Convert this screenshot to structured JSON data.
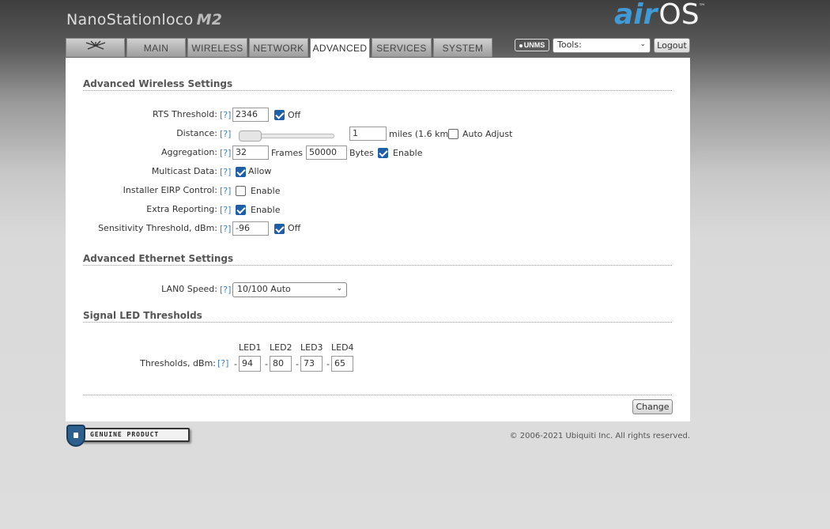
{
  "brand": {
    "name": "NanoStation",
    "model": "loco",
    "suffix": "M2"
  },
  "os_logo": {
    "air": "air",
    "os": "OS",
    "tm": "™"
  },
  "tabs": [
    {
      "label": "",
      "icon": "ubiquiti-logo-icon"
    },
    {
      "label": "MAIN"
    },
    {
      "label": "WIRELESS"
    },
    {
      "label": "NETWORK"
    },
    {
      "label": "ADVANCED",
      "active": true
    },
    {
      "label": "SERVICES"
    },
    {
      "label": "SYSTEM"
    }
  ],
  "header": {
    "unms_label": "UNMS",
    "tools": {
      "selected": "Tools:"
    },
    "logout_label": "Logout"
  },
  "advanced_wireless": {
    "title": "Advanced Wireless Settings",
    "help": "[?]",
    "rts": {
      "label": "RTS Threshold:",
      "value": "2346",
      "off_label": "Off",
      "off_checked": true
    },
    "distance": {
      "label": "Distance:",
      "value": "1",
      "unit": "miles (1.6 km)",
      "slider_fraction": 0.0,
      "auto_label": "Auto Adjust",
      "auto_checked": false
    },
    "aggregation": {
      "label": "Aggregation:",
      "frames_value": "32",
      "frames_label": "Frames",
      "bytes_value": "50000",
      "bytes_label": "Bytes",
      "enable_label": "Enable",
      "enable_checked": true
    },
    "multicast": {
      "label": "Multicast Data:",
      "allow_label": "Allow",
      "checked": true
    },
    "installer_eirp": {
      "label": "Installer EIRP Control:",
      "enable_label": "Enable",
      "checked": false
    },
    "extra_reporting": {
      "label": "Extra Reporting:",
      "enable_label": "Enable",
      "checked": true
    },
    "sensitivity": {
      "label": "Sensitivity Threshold, dBm:",
      "value": "-96",
      "off_label": "Off",
      "off_checked": true
    }
  },
  "advanced_ethernet": {
    "title": "Advanced Ethernet Settings",
    "lan0": {
      "label": "LAN0 Speed:",
      "selected": "10/100 Auto"
    }
  },
  "signal_led": {
    "title": "Signal LED Thresholds",
    "headers": [
      "LED1",
      "LED2",
      "LED3",
      "LED4"
    ],
    "label": "Thresholds, dBm:",
    "values": [
      "94",
      "80",
      "73",
      "65"
    ],
    "prefix": "-"
  },
  "change_label": "Change",
  "footer": {
    "genuine_text": "GENUINE  PRODUCT",
    "copyright": "© 2006-2021 Ubiquiti Inc. All rights reserved."
  },
  "colors": {
    "accent": "#3f9ad6",
    "checkbox": "#1f5fa8",
    "help_link": "#3b82c4"
  }
}
